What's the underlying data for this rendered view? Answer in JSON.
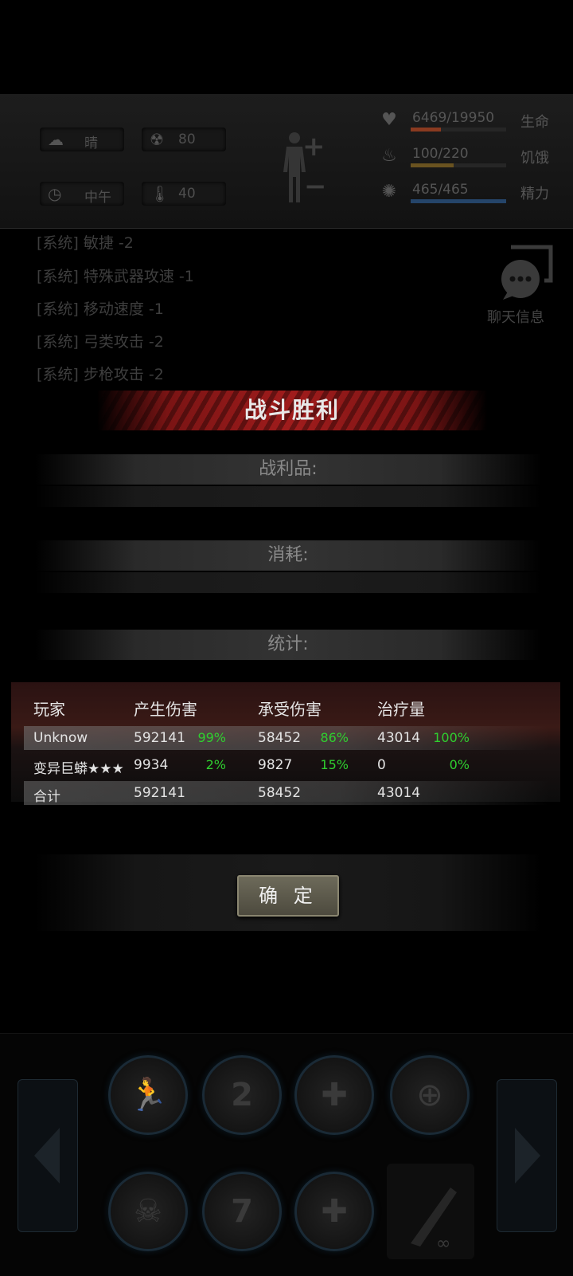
{
  "hud": {
    "weather": {
      "icon": "cloud-sun-icon",
      "label": "晴"
    },
    "radiation": {
      "icon": "radiation-icon",
      "value": "80"
    },
    "time": {
      "icon": "clock-icon",
      "label": "中午"
    },
    "temperature": {
      "icon": "thermometer-icon",
      "value": "40"
    },
    "body": {
      "plus": "+",
      "minus": "−"
    },
    "stats": [
      {
        "icon": "heart-icon",
        "glyph": "♥",
        "value": "6469/19950",
        "name": "生命",
        "fill": 0.32,
        "color": "#8a3a20"
      },
      {
        "icon": "stomach-icon",
        "glyph": "♨",
        "value": "100/220",
        "name": "饥饿",
        "fill": 0.45,
        "color": "#6a5320"
      },
      {
        "icon": "brain-icon",
        "glyph": "✺",
        "value": "465/465",
        "name": "精力",
        "fill": 1.0,
        "color": "#25456a"
      }
    ]
  },
  "chat_log": [
    "[系统] 敏捷 -2",
    "[系统] 特殊武器攻速 -1",
    "[系统] 移动速度 -1",
    "[系统] 弓类攻击 -2",
    "[系统] 步枪攻击 -2"
  ],
  "chat_button": {
    "label": "聊天信息"
  },
  "victory": {
    "title": "战斗胜利",
    "loot_label": "战利品:",
    "consume_label": "消耗:",
    "stats_label": "统计:",
    "headers": {
      "player": "玩家",
      "damage_dealt": "产生伤害",
      "damage_taken": "承受伤害",
      "healing": "治疗量"
    },
    "rows": [
      {
        "player": "Unknow",
        "dealt": "592141",
        "dealt_pct": "99%",
        "taken": "58452",
        "taken_pct": "86%",
        "heal": "43014",
        "heal_pct": "100%"
      },
      {
        "player": "变异巨蟒★★★",
        "dealt": "9934",
        "dealt_pct": "2%",
        "taken": "9827",
        "taken_pct": "15%",
        "heal": "0",
        "heal_pct": "0%"
      }
    ],
    "total": {
      "player": "合计",
      "dealt": "592141",
      "taken": "58452",
      "heal": "43014"
    },
    "confirm": "确 定"
  },
  "skills": {
    "prev_icon": "chevron-left-icon",
    "next_icon": "chevron-right-icon",
    "row1": [
      {
        "name": "skill-run",
        "glyph": "🏃"
      },
      {
        "name": "skill-combo",
        "glyph": "2"
      },
      {
        "name": "skill-heal",
        "glyph": "✚"
      },
      {
        "name": "skill-target",
        "glyph": "⊕"
      }
    ],
    "row2": [
      {
        "name": "skill-poison",
        "glyph": "☠"
      },
      {
        "name": "skill-seven",
        "glyph": "7"
      },
      {
        "name": "skill-medkit",
        "glyph": "✚"
      },
      {
        "name": "skill-melee",
        "glyph": "∞"
      }
    ]
  }
}
